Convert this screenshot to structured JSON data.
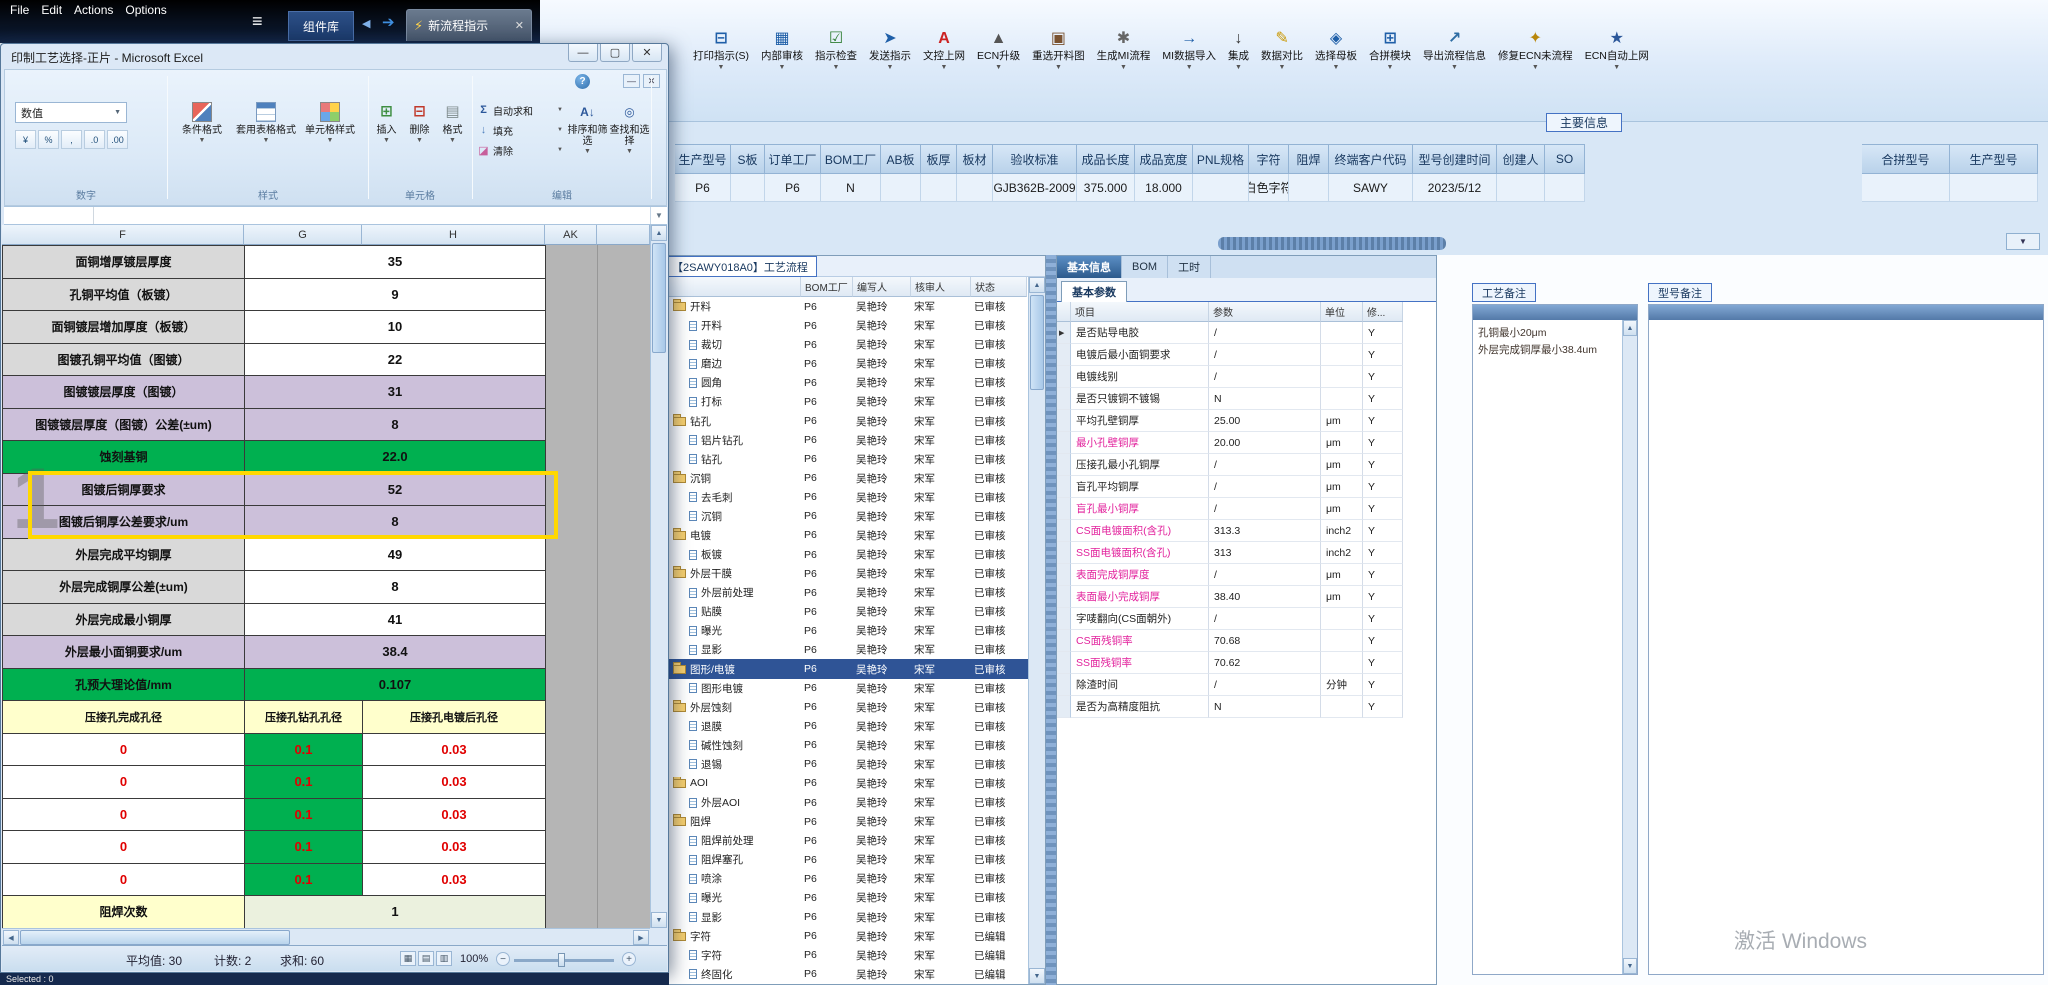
{
  "colors": {
    "selection": "#2f5496",
    "pink": "#e2219c",
    "green": "#00b050",
    "purple": "#ccc0da",
    "highlight": "#ffd800",
    "red": "#e00000"
  },
  "menu": {
    "items": [
      "File",
      "Edit",
      "Actions",
      "Options"
    ]
  },
  "tabs": {
    "library": "组件库",
    "active": "新流程指示"
  },
  "toolbar": {
    "buttons": [
      {
        "label": "打印指示(S)",
        "icon": "printer",
        "glyph": "⊟",
        "color": "#1f5fa8"
      },
      {
        "label": "内部审核",
        "icon": "internal-audit",
        "glyph": "▦",
        "color": "#1f5fa8"
      },
      {
        "label": "指示检查",
        "icon": "check",
        "glyph": "☑",
        "color": "#2e7d32"
      },
      {
        "label": "发送指示",
        "icon": "send",
        "glyph": "➤",
        "color": "#1f5fa8"
      },
      {
        "label": "文控上网",
        "icon": "doc-control",
        "glyph": "A",
        "color": "#cc2222"
      },
      {
        "label": "ECN升级",
        "icon": "ecn-upgrade",
        "glyph": "▲",
        "color": "#555555"
      },
      {
        "label": "重选开料图",
        "icon": "reselect-image",
        "glyph": "▣",
        "color": "#7a5230"
      },
      {
        "label": "生成MI流程",
        "icon": "generate-flow",
        "glyph": "✱",
        "color": "#666666"
      },
      {
        "label": "MI数据导入",
        "icon": "data-import",
        "glyph": "→",
        "color": "#1f5fa8"
      },
      {
        "label": "集成",
        "icon": "integrate",
        "glyph": "↓",
        "color": "#333333"
      },
      {
        "label": "数据对比",
        "icon": "data-compare",
        "glyph": "✎",
        "color": "#c99700"
      },
      {
        "label": "选择母板",
        "icon": "select-board",
        "glyph": "◈",
        "color": "#1f5fa8"
      },
      {
        "label": "合拼模块",
        "icon": "merge-module",
        "glyph": "⊞",
        "color": "#1f5fa8"
      },
      {
        "label": "导出流程信息",
        "icon": "export-flow",
        "glyph": "↗",
        "color": "#2e6da4"
      },
      {
        "label": "修复ECN未流程",
        "icon": "repair-ecn",
        "glyph": "✦",
        "color": "#b8860b"
      },
      {
        "label": "ECN自动上网",
        "icon": "ecn-auto",
        "glyph": "★",
        "color": "#2b579a"
      }
    ]
  },
  "main_info": {
    "title": "主要信息",
    "columns": [
      "生产型号",
      "S板",
      "订单工厂",
      "BOM工厂",
      "AB板",
      "板厚",
      "板材",
      "验收标准",
      "成品长度",
      "成品宽度",
      "PNL规格",
      "字符",
      "阻焊",
      "终端客户代码",
      "型号创建时间",
      "创建人",
      "SO"
    ],
    "values": [
      "P6",
      "",
      "P6",
      "N",
      "",
      "",
      "",
      "GJB362B-2009",
      "375.000",
      "18.000",
      "",
      "白色字符",
      "",
      "SAWY",
      "2023/5/12",
      "",
      ""
    ],
    "right_columns": [
      "合拼型号",
      "生产型号"
    ],
    "right_values": [
      "",
      ""
    ]
  },
  "excel": {
    "window_title": "印制工艺选择-正片 - Microsoft Excel",
    "number_format": "数值",
    "number_buttons": [
      "¥",
      "%",
      ",",
      ".0",
      ".00"
    ],
    "groups": {
      "number": "数字",
      "styles": "样式",
      "cells": "单元格",
      "editing": "编辑"
    },
    "style_buttons": [
      "条件格式",
      "套用表格格式",
      "单元格样式"
    ],
    "cell_buttons": [
      "插入",
      "删除",
      "格式"
    ],
    "edit_menu": [
      "自动求和",
      "填充",
      "清除"
    ],
    "edit_buttons": [
      "排序和筛选",
      "查找和选择"
    ],
    "col_headers": [
      "F",
      "G",
      "H",
      "AK"
    ],
    "rows": [
      {
        "label": "面铜增厚镀层厚度",
        "value": "35",
        "style": "plain"
      },
      {
        "label": "孔铜平均值（板镀）",
        "value": "9",
        "style": "plain"
      },
      {
        "label": "面铜镀层增加厚度（板镀）",
        "value": "10",
        "style": "plain"
      },
      {
        "label": "图镀孔铜平均值（图镀）",
        "value": "22",
        "style": "plain"
      },
      {
        "label": "图镀镀层厚度（图镀）",
        "value": "31",
        "style": "purple"
      },
      {
        "label": "图镀镀层厚度（图镀）公差(±um)",
        "value": "8",
        "style": "purple"
      },
      {
        "label": "蚀刻基铜",
        "value": "22.0",
        "style": "green"
      },
      {
        "label": "图镀后铜厚要求",
        "value": "52",
        "style": "purple"
      },
      {
        "label": "图镀后铜厚公差要求/um",
        "value": "8",
        "style": "purple"
      },
      {
        "label": "外层完成平均铜厚",
        "value": "49",
        "style": "plain"
      },
      {
        "label": "外层完成铜厚公差(±um)",
        "value": "8",
        "style": "plain"
      },
      {
        "label": "外层完成最小铜厚",
        "value": "41",
        "style": "plain"
      },
      {
        "label": "外层最小面铜要求/um",
        "value": "38.4",
        "style": "purple"
      },
      {
        "label": "孔预大理论值/mm",
        "value": "0.107",
        "style": "green"
      }
    ],
    "pressfit_headers": [
      "压接孔完成孔径",
      "压接孔钻孔孔径",
      "压接孔电镀后孔径"
    ],
    "pressfit_rows": [
      [
        "0",
        "0.1",
        "0.03"
      ],
      [
        "0",
        "0.1",
        "0.03"
      ],
      [
        "0",
        "0.1",
        "0.03"
      ],
      [
        "0",
        "0.1",
        "0.03"
      ],
      [
        "0",
        "0.1",
        "0.03"
      ]
    ],
    "solder": {
      "label": "阻焊次数",
      "value": "1"
    },
    "page_marker": "1",
    "status": {
      "average": "平均值: 30",
      "count": "计数: 2",
      "sum": "求和: 60",
      "zoom": "100%"
    },
    "selected_note": "Selected : 0"
  },
  "process_tree": {
    "title": "【2SAWY018A0】工艺流程",
    "columns": [
      "BOM工厂",
      "编写人",
      "核审人",
      "状态"
    ],
    "rows": [
      {
        "name": "开料",
        "type": "folder",
        "f": "P6",
        "w": "吴艳玲",
        "r": "宋军",
        "s": "已审核",
        "sel": false
      },
      {
        "name": "开料",
        "type": "doc",
        "f": "P6",
        "w": "吴艳玲",
        "r": "宋军",
        "s": "已审核",
        "sel": false
      },
      {
        "name": "裁切",
        "type": "doc",
        "f": "P6",
        "w": "吴艳玲",
        "r": "宋军",
        "s": "已审核",
        "sel": false
      },
      {
        "name": "磨边",
        "type": "doc",
        "f": "P6",
        "w": "吴艳玲",
        "r": "宋军",
        "s": "已审核",
        "sel": false
      },
      {
        "name": "圆角",
        "type": "doc",
        "f": "P6",
        "w": "吴艳玲",
        "r": "宋军",
        "s": "已审核",
        "sel": false
      },
      {
        "name": "打标",
        "type": "doc",
        "f": "P6",
        "w": "吴艳玲",
        "r": "宋军",
        "s": "已审核",
        "sel": false
      },
      {
        "name": "钻孔",
        "type": "folder",
        "f": "P6",
        "w": "吴艳玲",
        "r": "宋军",
        "s": "已审核",
        "sel": false
      },
      {
        "name": "铝片钻孔",
        "type": "doc",
        "f": "P6",
        "w": "吴艳玲",
        "r": "宋军",
        "s": "已审核",
        "sel": false
      },
      {
        "name": "钻孔",
        "type": "doc",
        "f": "P6",
        "w": "吴艳玲",
        "r": "宋军",
        "s": "已审核",
        "sel": false
      },
      {
        "name": "沉铜",
        "type": "folder",
        "f": "P6",
        "w": "吴艳玲",
        "r": "宋军",
        "s": "已审核",
        "sel": false
      },
      {
        "name": "去毛刺",
        "type": "doc",
        "f": "P6",
        "w": "吴艳玲",
        "r": "宋军",
        "s": "已审核",
        "sel": false
      },
      {
        "name": "沉铜",
        "type": "doc",
        "f": "P6",
        "w": "吴艳玲",
        "r": "宋军",
        "s": "已审核",
        "sel": false
      },
      {
        "name": "电镀",
        "type": "folder",
        "f": "P6",
        "w": "吴艳玲",
        "r": "宋军",
        "s": "已审核",
        "sel": false
      },
      {
        "name": "板镀",
        "type": "doc",
        "f": "P6",
        "w": "吴艳玲",
        "r": "宋军",
        "s": "已审核",
        "sel": false
      },
      {
        "name": "外层干膜",
        "type": "folder",
        "f": "P6",
        "w": "吴艳玲",
        "r": "宋军",
        "s": "已审核",
        "sel": false
      },
      {
        "name": "外层前处理",
        "type": "doc",
        "f": "P6",
        "w": "吴艳玲",
        "r": "宋军",
        "s": "已审核",
        "sel": false
      },
      {
        "name": "贴膜",
        "type": "doc",
        "f": "P6",
        "w": "吴艳玲",
        "r": "宋军",
        "s": "已审核",
        "sel": false
      },
      {
        "name": "曝光",
        "type": "doc",
        "f": "P6",
        "w": "吴艳玲",
        "r": "宋军",
        "s": "已审核",
        "sel": false
      },
      {
        "name": "显影",
        "type": "doc",
        "f": "P6",
        "w": "吴艳玲",
        "r": "宋军",
        "s": "已审核",
        "sel": false
      },
      {
        "name": "图形/电镀",
        "type": "folder",
        "f": "P6",
        "w": "吴艳玲",
        "r": "宋军",
        "s": "已审核",
        "sel": true
      },
      {
        "name": "图形电镀",
        "type": "doc",
        "f": "P6",
        "w": "吴艳玲",
        "r": "宋军",
        "s": "已审核",
        "sel": false
      },
      {
        "name": "外层蚀刻",
        "type": "folder",
        "f": "P6",
        "w": "吴艳玲",
        "r": "宋军",
        "s": "已审核",
        "sel": false
      },
      {
        "name": "退膜",
        "type": "doc",
        "f": "P6",
        "w": "吴艳玲",
        "r": "宋军",
        "s": "已审核",
        "sel": false
      },
      {
        "name": "碱性蚀刻",
        "type": "doc",
        "f": "P6",
        "w": "吴艳玲",
        "r": "宋军",
        "s": "已审核",
        "sel": false
      },
      {
        "name": "退锡",
        "type": "doc",
        "f": "P6",
        "w": "吴艳玲",
        "r": "宋军",
        "s": "已审核",
        "sel": false
      },
      {
        "name": "AOI",
        "type": "folder",
        "f": "P6",
        "w": "吴艳玲",
        "r": "宋军",
        "s": "已审核",
        "sel": false
      },
      {
        "name": "外层AOI",
        "type": "doc",
        "f": "P6",
        "w": "吴艳玲",
        "r": "宋军",
        "s": "已审核",
        "sel": false
      },
      {
        "name": "阻焊",
        "type": "folder",
        "f": "P6",
        "w": "吴艳玲",
        "r": "宋军",
        "s": "已审核",
        "sel": false
      },
      {
        "name": "阻焊前处理",
        "type": "doc",
        "f": "P6",
        "w": "吴艳玲",
        "r": "宋军",
        "s": "已审核",
        "sel": false
      },
      {
        "name": "阻焊塞孔",
        "type": "doc",
        "f": "P6",
        "w": "吴艳玲",
        "r": "宋军",
        "s": "已审核",
        "sel": false
      },
      {
        "name": "喷涂",
        "type": "doc",
        "f": "P6",
        "w": "吴艳玲",
        "r": "宋军",
        "s": "已审核",
        "sel": false
      },
      {
        "name": "曝光",
        "type": "doc",
        "f": "P6",
        "w": "吴艳玲",
        "r": "宋军",
        "s": "已审核",
        "sel": false
      },
      {
        "name": "显影",
        "type": "doc",
        "f": "P6",
        "w": "吴艳玲",
        "r": "宋军",
        "s": "已审核",
        "sel": false
      },
      {
        "name": "字符",
        "type": "folder",
        "f": "P6",
        "w": "吴艳玲",
        "r": "宋军",
        "s": "已编辑",
        "sel": false
      },
      {
        "name": "字符",
        "type": "doc",
        "f": "P6",
        "w": "吴艳玲",
        "r": "宋军",
        "s": "已编辑",
        "sel": false
      },
      {
        "name": "终固化",
        "type": "doc",
        "f": "P6",
        "w": "吴艳玲",
        "r": "宋军",
        "s": "已编辑",
        "sel": false
      }
    ]
  },
  "params": {
    "tabs": [
      "基本信息",
      "BOM",
      "工时"
    ],
    "subtab": "基本参数",
    "columns": [
      "项目",
      "参数",
      "单位",
      "修..."
    ],
    "flag": "Y",
    "rows": [
      {
        "item": "是否贴导电胶",
        "value": "/",
        "unit": "",
        "pink": false
      },
      {
        "item": "电镀后最小面铜要求",
        "value": "/",
        "unit": "",
        "pink": false
      },
      {
        "item": "电镀线别",
        "value": "/",
        "unit": "",
        "pink": false
      },
      {
        "item": "是否只镀铜不镀锡",
        "value": "N",
        "unit": "",
        "pink": false
      },
      {
        "item": "平均孔壁铜厚",
        "value": "25.00",
        "unit": "μm",
        "pink": false
      },
      {
        "item": "最小孔壁铜厚",
        "value": "20.00",
        "unit": "μm",
        "pink": true
      },
      {
        "item": "压接孔最小孔铜厚",
        "value": "/",
        "unit": "μm",
        "pink": false
      },
      {
        "item": "盲孔平均铜厚",
        "value": "/",
        "unit": "μm",
        "pink": false
      },
      {
        "item": "盲孔最小铜厚",
        "value": "/",
        "unit": "μm",
        "pink": true
      },
      {
        "item": "CS面电镀面积(含孔)",
        "value": "313.3",
        "unit": "inch2",
        "pink": true
      },
      {
        "item": "SS面电镀面积(含孔)",
        "value": "313",
        "unit": "inch2",
        "pink": true
      },
      {
        "item": "表面完成铜厚度",
        "value": "/",
        "unit": "μm",
        "pink": true
      },
      {
        "item": "表面最小完成铜厚",
        "value": "38.40",
        "unit": "μm",
        "pink": true
      },
      {
        "item": "字唛翻向(CS面朝外)",
        "value": "/",
        "unit": "",
        "pink": false
      },
      {
        "item": "CS面残铜率",
        "value": "70.68",
        "unit": "",
        "pink": true
      },
      {
        "item": "SS面残铜率",
        "value": "70.62",
        "unit": "",
        "pink": true
      },
      {
        "item": "除渣时间",
        "value": "/",
        "unit": "分钟",
        "pink": false
      },
      {
        "item": "是否为高精度阻抗",
        "value": "N",
        "unit": "",
        "pink": false
      }
    ]
  },
  "notes": {
    "process": {
      "title": "工艺备注",
      "lines": [
        "孔铜最小20μm",
        "外层完成铜厚最小38.4um"
      ]
    },
    "model": {
      "title": "型号备注"
    }
  },
  "footer": {
    "watermark": "激活 Windows"
  }
}
